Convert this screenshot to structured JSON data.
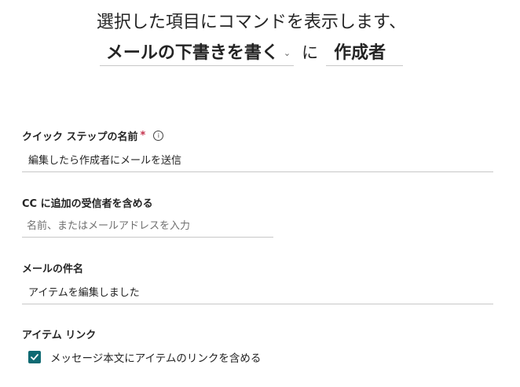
{
  "header": {
    "line1": "選択した項目にコマンドを表示します、",
    "action_value": "メールの下書きを書く",
    "connector": "に",
    "recipient_value": "作成者",
    "chevron_icon": "chevron-down-icon"
  },
  "fields": {
    "name": {
      "label": "クイック ステップの名前",
      "required_mark": "*",
      "info_icon": "ⓘ",
      "value": "編集したら作成者にメールを送信"
    },
    "cc": {
      "label": "CC に追加の受信者を含める",
      "placeholder": "名前、またはメールアドレスを入力"
    },
    "subject": {
      "label": "メールの件名",
      "value": "アイテムを編集しました"
    },
    "item_link": {
      "label": "アイテム リンク",
      "checkbox_label": "メッセージ本文にアイテムのリンクを含める",
      "checked": true
    }
  },
  "colors": {
    "accent": "#0f6a73",
    "required": "#c4314b",
    "border": "#c8c8c8"
  }
}
